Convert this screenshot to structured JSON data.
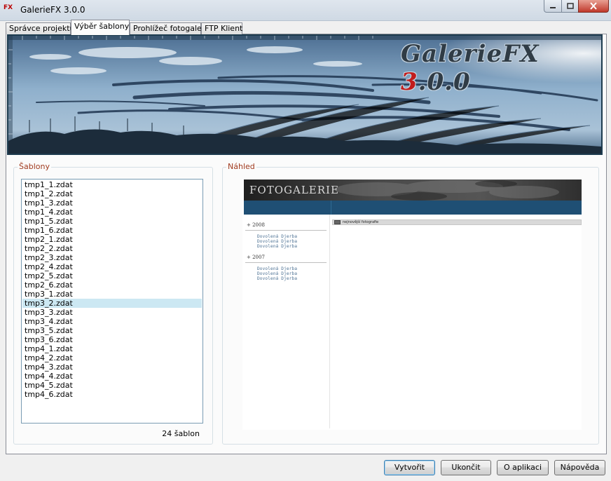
{
  "window": {
    "title": "GalerieFX 3.0.0",
    "icon_text": "FX",
    "controls": {
      "minimize": "minimize-icon",
      "maximize": "maximize-icon",
      "close": "close-icon"
    }
  },
  "tabs": [
    {
      "label": "Správce projektu",
      "active": false
    },
    {
      "label": "Výběr šablony",
      "active": true
    },
    {
      "label": "Prohlížeč fotogalerií",
      "active": false
    },
    {
      "label": "FTP Klient",
      "active": false
    }
  ],
  "banner": {
    "logo_main": "GalerieFX ",
    "logo_accent": "3",
    "logo_tail": ".0.0"
  },
  "templates": {
    "group_title": "Šablony",
    "items": [
      "tmp1_1.zdat",
      "tmp1_2.zdat",
      "tmp1_3.zdat",
      "tmp1_4.zdat",
      "tmp1_5.zdat",
      "tmp1_6.zdat",
      "tmp2_1.zdat",
      "tmp2_2.zdat",
      "tmp2_3.zdat",
      "tmp2_4.zdat",
      "tmp2_5.zdat",
      "tmp2_6.zdat",
      "tmp3_1.zdat",
      "tmp3_2.zdat",
      "tmp3_3.zdat",
      "tmp3_4.zdat",
      "tmp3_5.zdat",
      "tmp3_6.zdat",
      "tmp4_1.zdat",
      "tmp4_2.zdat",
      "tmp4_3.zdat",
      "tmp4_4.zdat",
      "tmp4_5.zdat",
      "tmp4_6.zdat"
    ],
    "selected_index": 13,
    "count_label": "24 šablon"
  },
  "preview": {
    "group_title": "Náhled",
    "header_title": "FOTOGALERIE",
    "years": [
      {
        "label": "+ 2008",
        "links": [
          "Dovolená Djerba",
          "Dovolená Djerba",
          "Dovolená Djerba"
        ]
      },
      {
        "label": "+ 2007",
        "links": [
          "Dovolená Djerba",
          "Dovolená Djerba",
          "Dovolená Djerba"
        ]
      }
    ],
    "tab_label": "nejnovější fotografie"
  },
  "buttons": {
    "create": "Vytvořit",
    "quit": "Ukončit",
    "about": "O aplikaci",
    "help": "Nápověda"
  },
  "colors": {
    "accent_title": "#a03a1e",
    "selection": "#cce8f3",
    "preview_bar": "#1f4f74"
  }
}
